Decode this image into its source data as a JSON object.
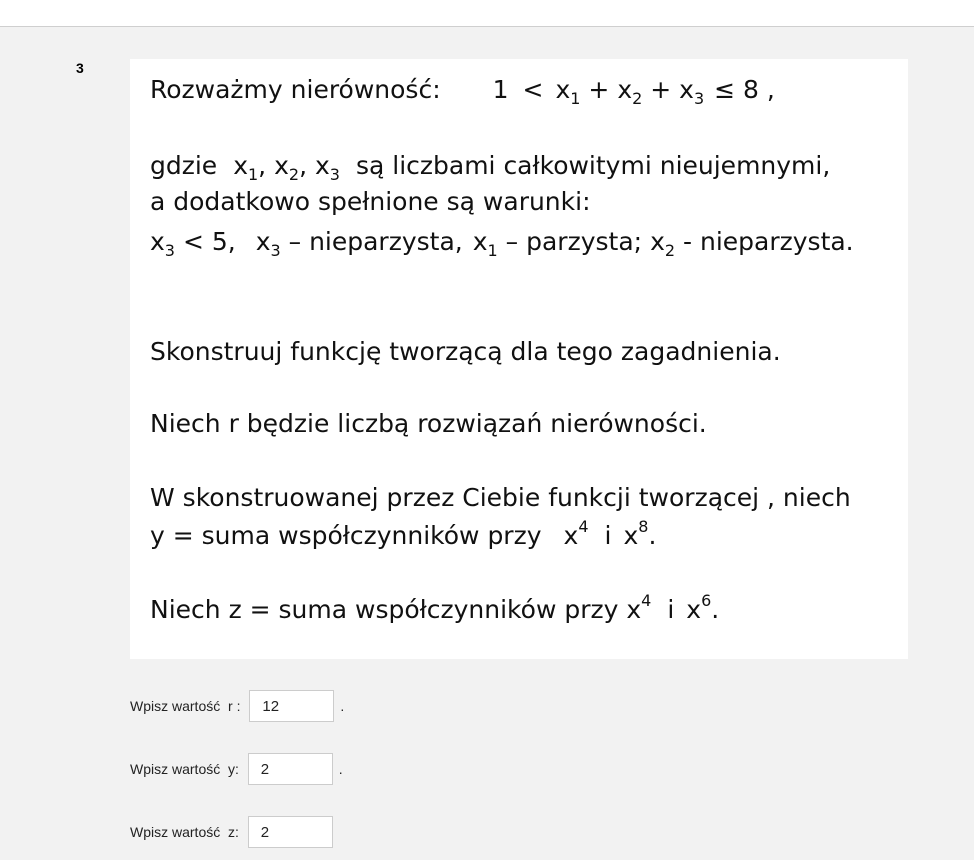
{
  "question": {
    "number": "3"
  },
  "task": {
    "l1": {
      "a": "Rozważmy nierówność:",
      "b": "1",
      "c": "<",
      "d": "x",
      "s1": "1",
      "e": "+ x",
      "s2": "2",
      "f": "+ x",
      "s3": "3",
      "g": "≤  8 ,"
    },
    "l2": {
      "a": "gdzie",
      "b": "x",
      "s1": "1",
      "c": ",  x",
      "s2": "2",
      "d": ",  x",
      "s3": "3",
      "e": "są liczbami całkowitymi nieujemnymi,"
    },
    "l3": "a  dodatkowo spełnione są warunki:",
    "l4": {
      "a": "x",
      "s1": "3",
      "b": "<   5,",
      "c": "x",
      "s2": "3",
      "d": "– nieparzysta,",
      "e": "x",
      "s3": "1",
      "f": "– parzysta;",
      "g": "x",
      "s4": "2",
      "h": "- nieparzysta."
    },
    "l5": "Skonstruuj funkcję tworzącą dla tego zagadnienia.",
    "l6": "Niech r  będzie liczbą rozwiązań nierówności.",
    "l7": "W skonstruowanej przez Ciebie funkcji tworzącej , niech",
    "l8": {
      "a": "y  =  suma współczynników przy",
      "b": "x",
      "p1": "4",
      "c": "i",
      "d": "x",
      "p2": "8",
      "e": "."
    },
    "l9": {
      "a": "Niech  z = suma współczynników przy x",
      "p1": "4",
      "c": "i",
      "d": "x",
      "p2": "6",
      "e": "."
    }
  },
  "answers": {
    "r": {
      "label": "Wpisz wartość  r : ",
      "value": "12",
      "suffix": "."
    },
    "y": {
      "label": "Wpisz wartość  y: ",
      "value": "2",
      "suffix": "."
    },
    "z": {
      "label": "Wpisz wartość  z: ",
      "value": "2"
    }
  }
}
